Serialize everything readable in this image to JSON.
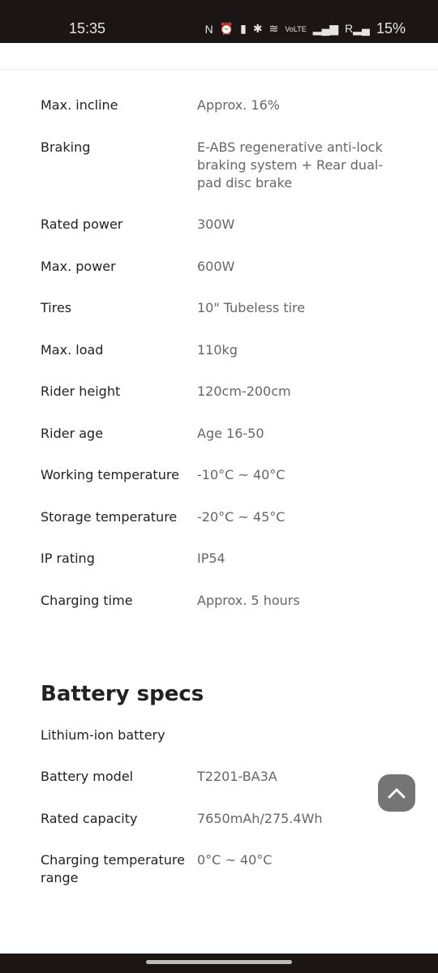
{
  "status_bar": {
    "time": "15:35",
    "battery": "15%",
    "icons": [
      "nfc-icon",
      "alarm-icon",
      "vibrate-icon",
      "bluetooth-icon",
      "wifi-icon",
      "volte-icon",
      "signal-icon",
      "signal-roaming-icon"
    ]
  },
  "specs": [
    {
      "label": "Max. incline",
      "value": "Approx. 16%"
    },
    {
      "label": "Braking",
      "value": "E-ABS regenerative anti-lock braking system + Rear dual-pad disc brake"
    },
    {
      "label": "Rated power",
      "value": "300W"
    },
    {
      "label": "Max. power",
      "value": "600W"
    },
    {
      "label": "Tires",
      "value": "10\" Tubeless tire"
    },
    {
      "label": "Max. load",
      "value": "110kg"
    },
    {
      "label": "Rider height",
      "value": "120cm-200cm"
    },
    {
      "label": "Rider age",
      "value": "Age 16-50"
    },
    {
      "label": "Working temperature",
      "value": "-10°C ~ 40°C"
    },
    {
      "label": "Storage temperature",
      "value": "-20°C ~ 45°C"
    },
    {
      "label": "IP rating",
      "value": "IP54"
    },
    {
      "label": "Charging time",
      "value": "Approx. 5 hours"
    }
  ],
  "battery": {
    "heading": "Battery specs",
    "specs": [
      {
        "label": "Lithium-ion battery",
        "value": ""
      },
      {
        "label": "Battery model",
        "value": "T2201-BA3A"
      },
      {
        "label": "Rated capacity",
        "value": "7650mAh/275.4Wh"
      },
      {
        "label": "Charging temperature range",
        "value": "0°C ~ 40°C"
      }
    ]
  }
}
